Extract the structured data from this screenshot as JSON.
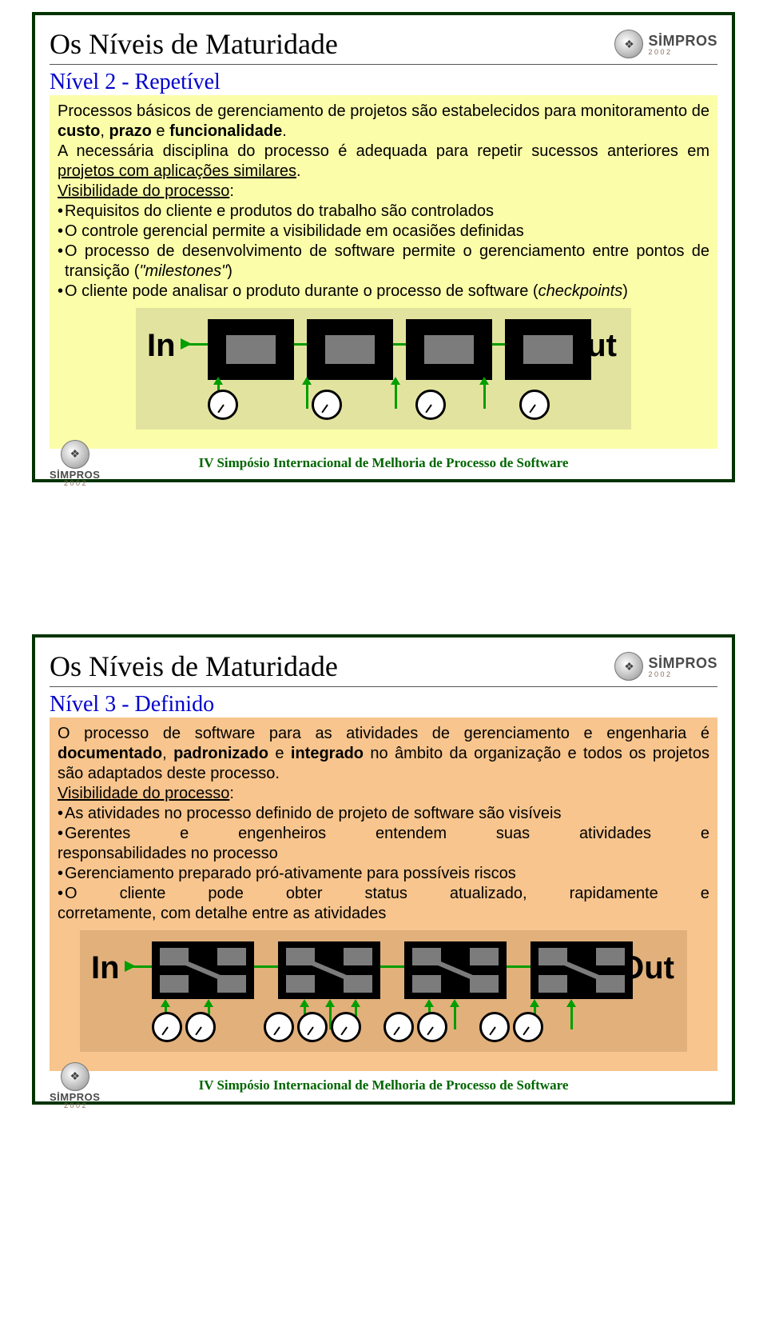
{
  "brand": {
    "name": "SİMPROS",
    "year": "2 0 0 2",
    "icon_glyph": "❖"
  },
  "footer": "IV Simpósio Internacional de Melhoria de Processo de Software",
  "slide1": {
    "title": "Os Níveis de Maturidade",
    "subtitle": "Nível 2 - Repetível",
    "p1a": "Processos básicos de gerenciamento de projetos são estabelecidos para monitoramento de ",
    "p1b": "custo",
    "p1c": ", ",
    "p1d": "prazo",
    "p1e": " e ",
    "p1f": "funcionalidade",
    "p1g": ".",
    "p2a": "A necessária disciplina do processo é adequada para repetir sucessos anteriores em ",
    "p2b": "projetos com aplicações similares",
    "p2c": ".",
    "vis": "Visibilidade do processo",
    "b1": "Requisitos do cliente e produtos do trabalho são controlados",
    "b2": "O controle gerencial permite a visibilidade em ocasiões definidas",
    "b3a": "O processo de desenvolvimento de software permite o gerenciamento entre pontos de transição (",
    "b3b": "\"milestones\"",
    "b3c": ")",
    "b4a": "O cliente pode analisar o produto durante o processo de software (",
    "b4b": "checkpoints",
    "b4c": ")",
    "in": "In",
    "out": "Out"
  },
  "slide2": {
    "title": "Os Níveis de Maturidade",
    "subtitle": "Nível 3 - Definido",
    "p1a": "O processo de software  para as atividades de gerenciamento e engenharia é ",
    "p1b": "documentado",
    "p1c": ", ",
    "p1d": "padronizado",
    "p1e": " e ",
    "p1f": "integrado",
    "p1g": " no âmbito da organização e todos os projetos são adaptados deste processo.",
    "vis": "Visibilidade do processo",
    "b1": "As atividades no processo definido de projeto de software são visíveis",
    "b2w": [
      "Gerentes",
      "e",
      "engenheiros",
      "entendem",
      "suas",
      "atividades",
      "e"
    ],
    "b2cont": "responsabilidades no processo",
    "b3": "Gerenciamento preparado pró-ativamente para possíveis riscos",
    "b4w": [
      "O",
      "cliente",
      "pode",
      "obter",
      "status",
      "atualizado,",
      "rapidamente",
      "e"
    ],
    "b4cont": "corretamente, com detalhe entre as atividades",
    "in": "In",
    "out": "Out"
  }
}
